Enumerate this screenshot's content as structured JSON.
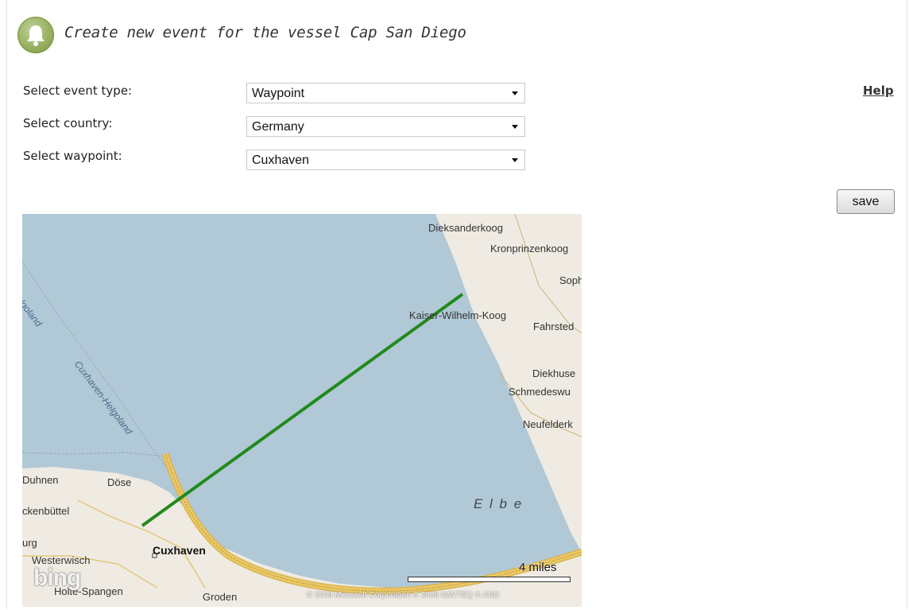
{
  "header": {
    "title": "Create new event for the vessel Cap San Diego",
    "icon": "bell-icon"
  },
  "form": {
    "event_type": {
      "label": "Select event type:",
      "value": "Waypoint"
    },
    "country": {
      "label": "Select country:",
      "value": "Germany"
    },
    "waypoint": {
      "label": "Select waypoint:",
      "value": "Cuxhaven"
    }
  },
  "help_link": "Help",
  "save_button": "save",
  "map": {
    "labels": {
      "dieksanderkoog": "Dieksanderkoog",
      "kronprinzenkoog": "Kronprinzenkoog",
      "soph": "Soph",
      "kaiser_wilhelm_koog": "Kaiser-Wilhelm-Koog",
      "fahrsted": "Fahrsted",
      "diekhuse": "Diekhuse",
      "schmedeswu": "Schmedeswu",
      "neufelderk": "Neufelderk",
      "helgoland_route_top": "-Helgoland",
      "cuxhaven_helgoland_route": "Cuxhaven-Helgoland",
      "duhnen": "Duhnen",
      "dose": "Döse",
      "ckenbuttel": "ckenbüttel",
      "urg": "urg",
      "cuxhaven": "Cuxhaven",
      "westerwisch": "Westerwisch",
      "holte_spangen": "Holte-Spangen",
      "groden": "Groden",
      "elbe": "E  l  b  e"
    },
    "logo": "bing",
    "scale": "4 miles",
    "copyright": "© 2009 Microsoft Corporation   © 2009 NAVTEQ   © AND",
    "colors": {
      "water": "#b1c8d6",
      "land": "#efebe2",
      "route_line": "#218a1c",
      "highway": "#e8c35a"
    }
  }
}
